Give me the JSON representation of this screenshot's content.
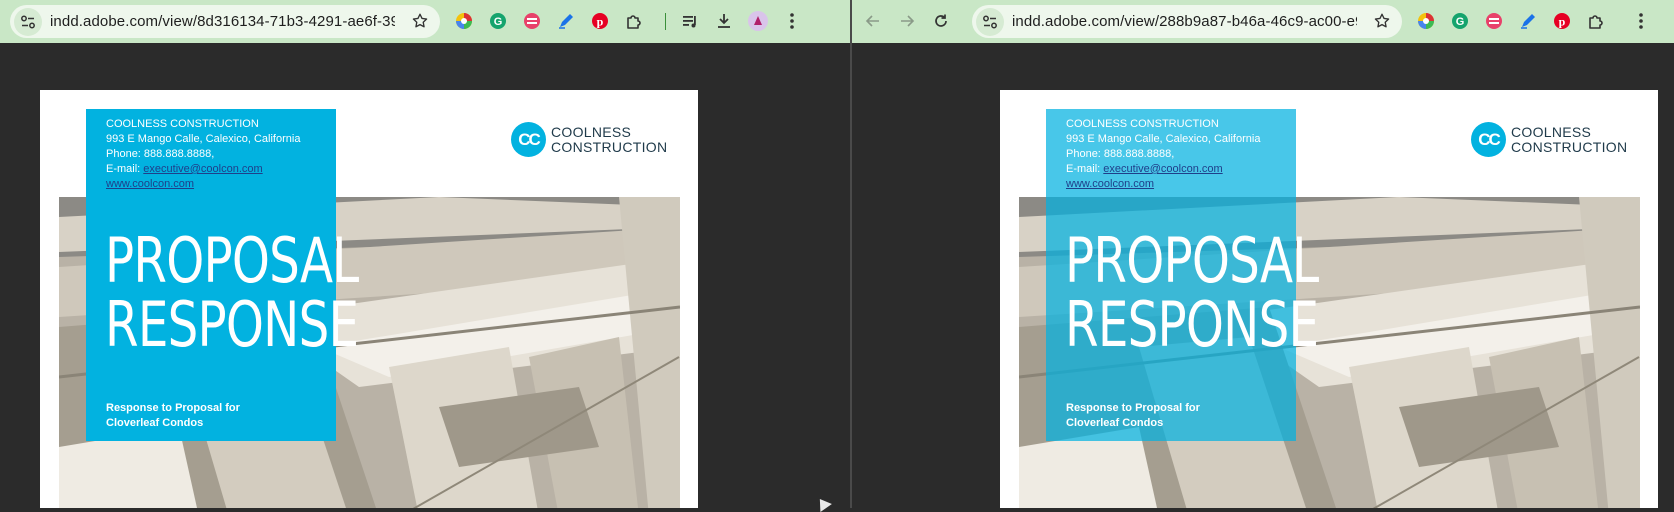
{
  "left_window": {
    "url": "indd.adobe.com/view/8d316134-71b3-4291-ae6f-399129..."
  },
  "right_window": {
    "url": "indd.adobe.com/view/288b9a87-b46a-46c9-ac00-e9de86..."
  },
  "toolbar": {
    "back_icon": "arrow-left-icon",
    "forward_icon": "arrow-right-icon",
    "reload_icon": "reload-icon",
    "site_info_icon": "tune-icon",
    "bookmark_icon": "star-icon",
    "extension_icons": [
      "color-wheel-icon",
      "grammarly-icon",
      "cross-site-icon",
      "highlighter-icon",
      "pinterest-icon",
      "puzzle-icon"
    ],
    "menu_icons": [
      "media-queue-icon",
      "download-icon",
      "profile-avatar",
      "more-vert-icon"
    ]
  },
  "document": {
    "company_name": "COOLNESS CONSTRUCTION",
    "address": "993 E Mango Calle, Calexico, California",
    "phone": "Phone: 888.888.8888,",
    "email_label": "E-mail: ",
    "email": "executive@coolcon.com",
    "website": "www.coolcon.com",
    "title_line1": "PROPOSAL",
    "title_line2": "RESPONSE",
    "subtitle_line1": "Response to Proposal for",
    "subtitle_line2": "Cloverleaf Condos",
    "logo_mark": "CC",
    "logo_line1": "COOLNESS",
    "logo_line2": "CONSTRUCTION"
  },
  "colors": {
    "panel": "#02b2e0",
    "toolbar": "#c9e7c6",
    "viewer_background": "#2b2b2b"
  }
}
